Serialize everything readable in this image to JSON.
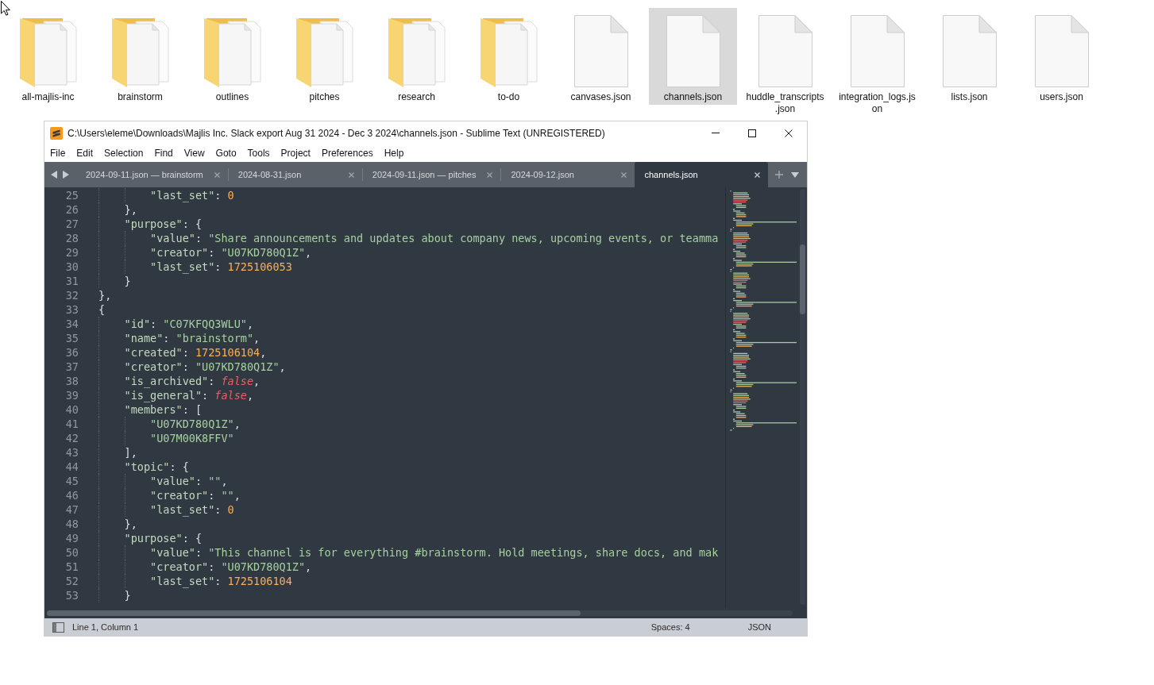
{
  "desktop": {
    "items": [
      {
        "kind": "folder",
        "label": "all-majlis-inc",
        "selected": false
      },
      {
        "kind": "folder",
        "label": "brainstorm",
        "selected": false
      },
      {
        "kind": "folder",
        "label": "outlines",
        "selected": false
      },
      {
        "kind": "folder",
        "label": "pitches",
        "selected": false
      },
      {
        "kind": "folder",
        "label": "research",
        "selected": false
      },
      {
        "kind": "folder",
        "label": "to-do",
        "selected": false
      },
      {
        "kind": "file",
        "label": "canvases.json",
        "selected": false
      },
      {
        "kind": "file",
        "label": "channels.json",
        "selected": true
      },
      {
        "kind": "file",
        "label": "huddle_transcripts\n.json",
        "selected": false
      },
      {
        "kind": "file",
        "label": "integration_logs.js\non",
        "selected": false
      },
      {
        "kind": "file",
        "label": "lists.json",
        "selected": false
      },
      {
        "kind": "file",
        "label": "users.json",
        "selected": false
      }
    ]
  },
  "window": {
    "title": "C:\\Users\\eleme\\Downloads\\Majlis Inc. Slack export Aug 31 2024 - Dec 3 2024\\channels.json - Sublime Text (UNREGISTERED)"
  },
  "menu": [
    "File",
    "Edit",
    "Selection",
    "Find",
    "View",
    "Goto",
    "Tools",
    "Project",
    "Preferences",
    "Help"
  ],
  "tabs": [
    {
      "label": "2024-09-11.json — brainstorm",
      "selected": false
    },
    {
      "label": "2024-08-31.json",
      "selected": false
    },
    {
      "label": "2024-09-11.json — pitches",
      "selected": false
    },
    {
      "label": "2024-09-12.json",
      "selected": false
    },
    {
      "label": "channels.json",
      "selected": true
    }
  ],
  "editor": {
    "lines": [
      {
        "number": "25",
        "tokens": [
          {
            "kind": "key",
            "text": "        \"last_set\""
          },
          {
            "kind": "punct",
            "text": ": "
          },
          {
            "kind": "number",
            "text": "0"
          }
        ]
      },
      {
        "number": "26",
        "tokens": [
          {
            "kind": "punct",
            "text": "    },"
          }
        ]
      },
      {
        "number": "27",
        "tokens": [
          {
            "kind": "key",
            "text": "    \"purpose\""
          },
          {
            "kind": "punct",
            "text": ": {"
          }
        ]
      },
      {
        "number": "28",
        "tokens": [
          {
            "kind": "key",
            "text": "        \"value\""
          },
          {
            "kind": "punct",
            "text": ": "
          },
          {
            "kind": "string",
            "text": "\"Share announcements and updates about company news, upcoming events, or teamma"
          }
        ]
      },
      {
        "number": "29",
        "tokens": [
          {
            "kind": "key",
            "text": "        \"creator\""
          },
          {
            "kind": "punct",
            "text": ": "
          },
          {
            "kind": "string",
            "text": "\"U07KD780Q1Z\""
          },
          {
            "kind": "punct",
            "text": ","
          }
        ]
      },
      {
        "number": "30",
        "tokens": [
          {
            "kind": "key",
            "text": "        \"last_set\""
          },
          {
            "kind": "punct",
            "text": ": "
          },
          {
            "kind": "number",
            "text": "1725106053"
          }
        ]
      },
      {
        "number": "31",
        "tokens": [
          {
            "kind": "punct",
            "text": "    }"
          }
        ]
      },
      {
        "number": "32",
        "tokens": [
          {
            "kind": "punct",
            "text": "},"
          }
        ]
      },
      {
        "number": "33",
        "tokens": [
          {
            "kind": "punct",
            "text": "{"
          }
        ]
      },
      {
        "number": "34",
        "tokens": [
          {
            "kind": "key",
            "text": "    \"id\""
          },
          {
            "kind": "punct",
            "text": ": "
          },
          {
            "kind": "string",
            "text": "\"C07KFQQ3WLU\""
          },
          {
            "kind": "punct",
            "text": ","
          }
        ]
      },
      {
        "number": "35",
        "tokens": [
          {
            "kind": "key",
            "text": "    \"name\""
          },
          {
            "kind": "punct",
            "text": ": "
          },
          {
            "kind": "string",
            "text": "\"brainstorm\""
          },
          {
            "kind": "punct",
            "text": ","
          }
        ]
      },
      {
        "number": "36",
        "tokens": [
          {
            "kind": "key",
            "text": "    \"created\""
          },
          {
            "kind": "punct",
            "text": ": "
          },
          {
            "kind": "number",
            "text": "1725106104"
          },
          {
            "kind": "punct",
            "text": ","
          }
        ]
      },
      {
        "number": "37",
        "tokens": [
          {
            "kind": "key",
            "text": "    \"creator\""
          },
          {
            "kind": "punct",
            "text": ": "
          },
          {
            "kind": "string",
            "text": "\"U07KD780Q1Z\""
          },
          {
            "kind": "punct",
            "text": ","
          }
        ]
      },
      {
        "number": "38",
        "tokens": [
          {
            "kind": "key",
            "text": "    \"is_archived\""
          },
          {
            "kind": "punct",
            "text": ": "
          },
          {
            "kind": "boolean",
            "text": "false"
          },
          {
            "kind": "punct",
            "text": ","
          }
        ]
      },
      {
        "number": "39",
        "tokens": [
          {
            "kind": "key",
            "text": "    \"is_general\""
          },
          {
            "kind": "punct",
            "text": ": "
          },
          {
            "kind": "boolean",
            "text": "false"
          },
          {
            "kind": "punct",
            "text": ","
          }
        ]
      },
      {
        "number": "40",
        "tokens": [
          {
            "kind": "key",
            "text": "    \"members\""
          },
          {
            "kind": "punct",
            "text": ": ["
          }
        ]
      },
      {
        "number": "41",
        "tokens": [
          {
            "kind": "string",
            "text": "        \"U07KD780Q1Z\""
          },
          {
            "kind": "punct",
            "text": ","
          }
        ]
      },
      {
        "number": "42",
        "tokens": [
          {
            "kind": "string",
            "text": "        \"U07M00K8FFV\""
          }
        ]
      },
      {
        "number": "43",
        "tokens": [
          {
            "kind": "punct",
            "text": "    ],"
          }
        ]
      },
      {
        "number": "44",
        "tokens": [
          {
            "kind": "key",
            "text": "    \"topic\""
          },
          {
            "kind": "punct",
            "text": ": {"
          }
        ]
      },
      {
        "number": "45",
        "tokens": [
          {
            "kind": "key",
            "text": "        \"value\""
          },
          {
            "kind": "punct",
            "text": ": "
          },
          {
            "kind": "string",
            "text": "\"\""
          },
          {
            "kind": "punct",
            "text": ","
          }
        ]
      },
      {
        "number": "46",
        "tokens": [
          {
            "kind": "key",
            "text": "        \"creator\""
          },
          {
            "kind": "punct",
            "text": ": "
          },
          {
            "kind": "string",
            "text": "\"\""
          },
          {
            "kind": "punct",
            "text": ","
          }
        ]
      },
      {
        "number": "47",
        "tokens": [
          {
            "kind": "key",
            "text": "        \"last_set\""
          },
          {
            "kind": "punct",
            "text": ": "
          },
          {
            "kind": "number",
            "text": "0"
          }
        ]
      },
      {
        "number": "48",
        "tokens": [
          {
            "kind": "punct",
            "text": "    },"
          }
        ]
      },
      {
        "number": "49",
        "tokens": [
          {
            "kind": "key",
            "text": "    \"purpose\""
          },
          {
            "kind": "punct",
            "text": ": {"
          }
        ]
      },
      {
        "number": "50",
        "tokens": [
          {
            "kind": "key",
            "text": "        \"value\""
          },
          {
            "kind": "punct",
            "text": ": "
          },
          {
            "kind": "string",
            "text": "\"This channel is for everything #brainstorm. Hold meetings, share docs, and mak"
          }
        ]
      },
      {
        "number": "51",
        "tokens": [
          {
            "kind": "key",
            "text": "        \"creator\""
          },
          {
            "kind": "punct",
            "text": ": "
          },
          {
            "kind": "string",
            "text": "\"U07KD780Q1Z\""
          },
          {
            "kind": "punct",
            "text": ","
          }
        ]
      },
      {
        "number": "52",
        "tokens": [
          {
            "kind": "key",
            "text": "        \"last_set\""
          },
          {
            "kind": "punct",
            "text": ": "
          },
          {
            "kind": "number",
            "text": "1725106104"
          }
        ]
      },
      {
        "number": "53",
        "tokens": [
          {
            "kind": "punct",
            "text": "    }"
          }
        ]
      }
    ]
  },
  "status_bar": {
    "position": "Line 1, Column 1",
    "indentation": "Spaces: 4",
    "syntax": "JSON"
  }
}
